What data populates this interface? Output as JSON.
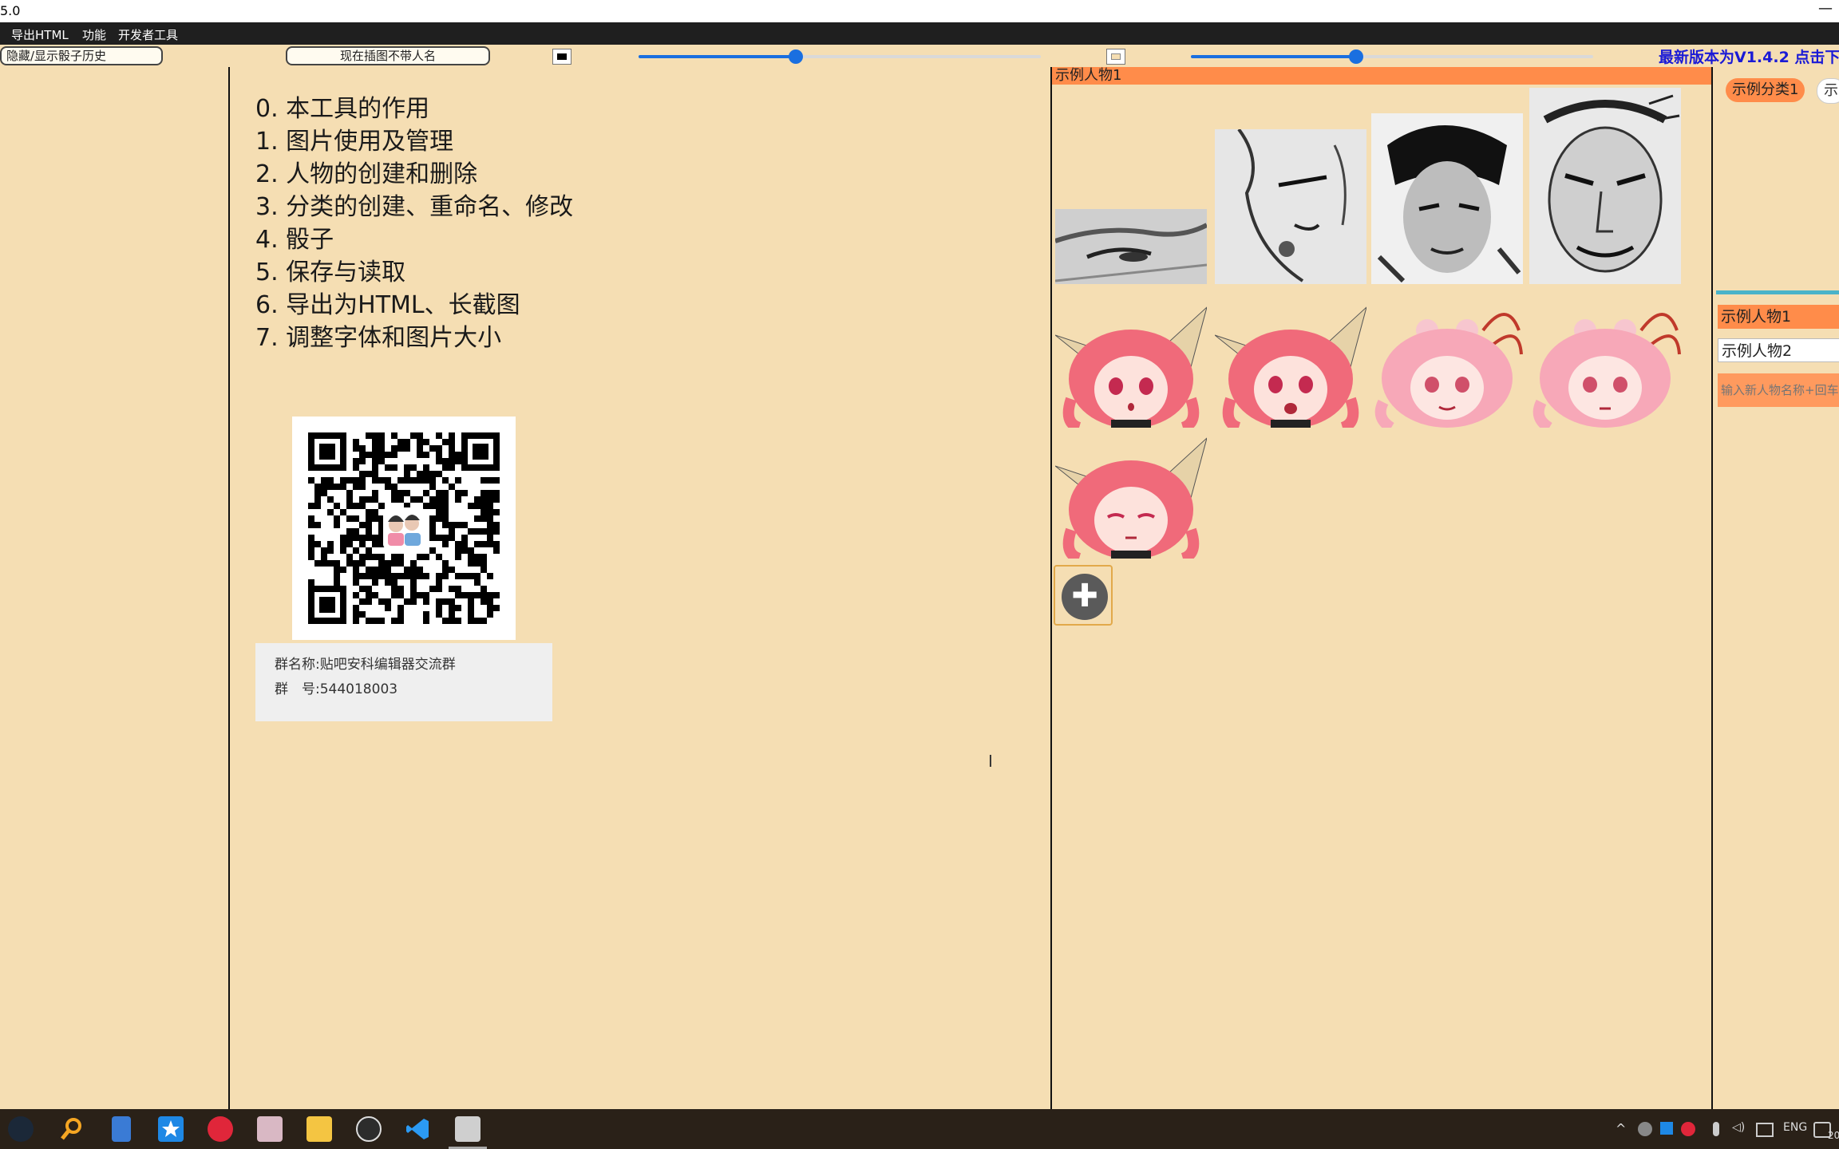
{
  "window": {
    "title": "5.0",
    "minimize_glyph": "—"
  },
  "menu": {
    "items": [
      "导出HTML",
      "功能",
      "开发者工具"
    ]
  },
  "toolbar": {
    "toggle_dice_history": "隐藏/显示骰子历史",
    "name_toggle": "现在插图不带人名",
    "slider1_value": 0.39,
    "slider2_value": 0.41,
    "version_link": "最新版本为V1.4.2 点击下",
    "colors": {
      "slider": "#1a6fe0",
      "version_link": "#1a1ad6"
    }
  },
  "help": {
    "items": [
      "0. 本工具的作用",
      "1. 图片使用及管理",
      "2. 人物的创建和删除",
      "3. 分类的创建、重命名、修改",
      "4. 骰子",
      "5. 保存与读取",
      "6. 导出为HTML、长截图",
      "7. 调整字体和图片大小"
    ],
    "group_name": "群名称:贴吧安科编辑器交流群",
    "group_number": "群　号:544018003"
  },
  "gallery": {
    "character_header": "示例人物1",
    "accent": "#ff8c4a",
    "add_button_glyph": "✚"
  },
  "right_panel": {
    "categories": [
      "示例分类1",
      "示"
    ],
    "characters": [
      "示例人物1",
      "示例人物2"
    ],
    "new_character_placeholder": "输入新人物名称+回车"
  },
  "taskbar": {
    "icons": [
      "steam-icon",
      "search-icon",
      "calculator-icon",
      "star-app-icon",
      "netease-music-icon",
      "photo-app-icon",
      "file-explorer-icon",
      "obs-icon",
      "vscode-icon",
      "editor-app-icon"
    ],
    "tray_language": "ENG",
    "clock_fragment": "20"
  }
}
